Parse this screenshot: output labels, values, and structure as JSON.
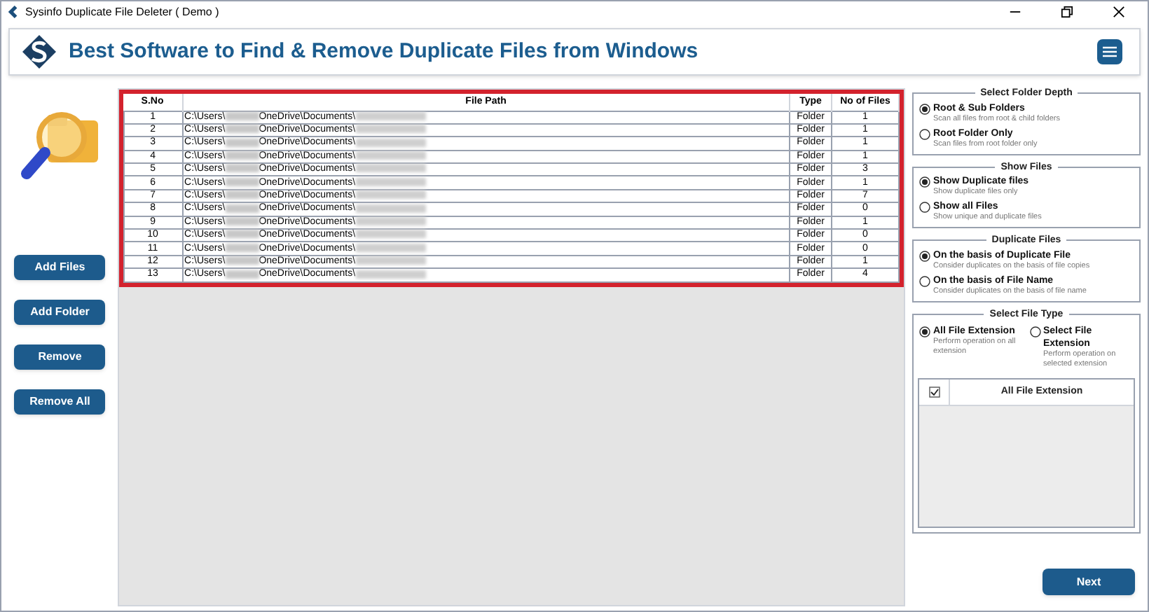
{
  "window": {
    "title": "Sysinfo Duplicate File Deleter ( Demo )"
  },
  "header": {
    "title": "Best Software to Find & Remove Duplicate Files from Windows"
  },
  "left_buttons": [
    "Add Files",
    "Add Folder",
    "Remove",
    "Remove All"
  ],
  "table": {
    "columns": [
      "S.No",
      "File Path",
      "Type",
      "No of Files"
    ],
    "rows": [
      {
        "sno": "1",
        "path_start": "C:\\Users\\",
        "path_mid": "OneDrive\\Documents\\",
        "type": "Folder",
        "count": "1"
      },
      {
        "sno": "2",
        "path_start": "C:\\Users\\",
        "path_mid": "OneDrive\\Documents\\",
        "type": "Folder",
        "count": "1"
      },
      {
        "sno": "3",
        "path_start": "C:\\Users\\",
        "path_mid": "OneDrive\\Documents\\",
        "type": "Folder",
        "count": "1"
      },
      {
        "sno": "4",
        "path_start": "C:\\Users\\",
        "path_mid": "OneDrive\\Documents\\",
        "type": "Folder",
        "count": "1"
      },
      {
        "sno": "5",
        "path_start": "C:\\Users\\",
        "path_mid": "OneDrive\\Documents\\",
        "type": "Folder",
        "count": "3"
      },
      {
        "sno": "6",
        "path_start": "C:\\Users\\",
        "path_mid": "OneDrive\\Documents\\",
        "type": "Folder",
        "count": "1"
      },
      {
        "sno": "7",
        "path_start": "C:\\Users\\",
        "path_mid": "OneDrive\\Documents\\",
        "type": "Folder",
        "count": "7"
      },
      {
        "sno": "8",
        "path_start": "C:\\Users\\",
        "path_mid": "OneDrive\\Documents\\",
        "type": "Folder",
        "count": "0"
      },
      {
        "sno": "9",
        "path_start": "C:\\Users\\",
        "path_mid": "OneDrive\\Documents\\",
        "type": "Folder",
        "count": "1"
      },
      {
        "sno": "10",
        "path_start": "C:\\Users\\",
        "path_mid": "OneDrive\\Documents\\",
        "type": "Folder",
        "count": "0"
      },
      {
        "sno": "11",
        "path_start": "C:\\Users\\",
        "path_mid": "OneDrive\\Documents\\",
        "type": "Folder",
        "count": "0"
      },
      {
        "sno": "12",
        "path_start": "C:\\Users\\",
        "path_mid": "OneDrive\\Documents\\",
        "type": "Folder",
        "count": "1"
      },
      {
        "sno": "13",
        "path_start": "C:\\Users\\",
        "path_mid": "OneDrive\\Documents\\",
        "type": "Folder",
        "count": "4"
      }
    ]
  },
  "groups": [
    {
      "title": "Select Folder Depth",
      "options": [
        {
          "label": "Root & Sub Folders",
          "hint": "Scan all files from root & child folders",
          "selected": true
        },
        {
          "label": "Root Folder Only",
          "hint": "Scan files from root folder only",
          "selected": false
        }
      ]
    },
    {
      "title": "Show Files",
      "options": [
        {
          "label": "Show Duplicate files",
          "hint": "Show duplicate files only",
          "selected": true
        },
        {
          "label": "Show all Files",
          "hint": "Show unique and duplicate files",
          "selected": false
        }
      ]
    },
    {
      "title": "Duplicate Files",
      "options": [
        {
          "label": "On the basis of Duplicate File",
          "hint": "Consider duplicates on the basis of file copies",
          "selected": true
        },
        {
          "label": "On the basis of File Name",
          "hint": "Consider duplicates on the basis of file name",
          "selected": false
        }
      ]
    }
  ],
  "file_type": {
    "title": "Select File Type",
    "options": [
      {
        "label": "All File Extension",
        "hint": "Perform operation on all extension",
        "selected": true
      },
      {
        "label": "Select File Extension",
        "hint": "Perform operation on selected extension",
        "selected": false
      }
    ],
    "list": {
      "checked": true,
      "header": "All File Extension"
    }
  },
  "next_button": "Next"
}
